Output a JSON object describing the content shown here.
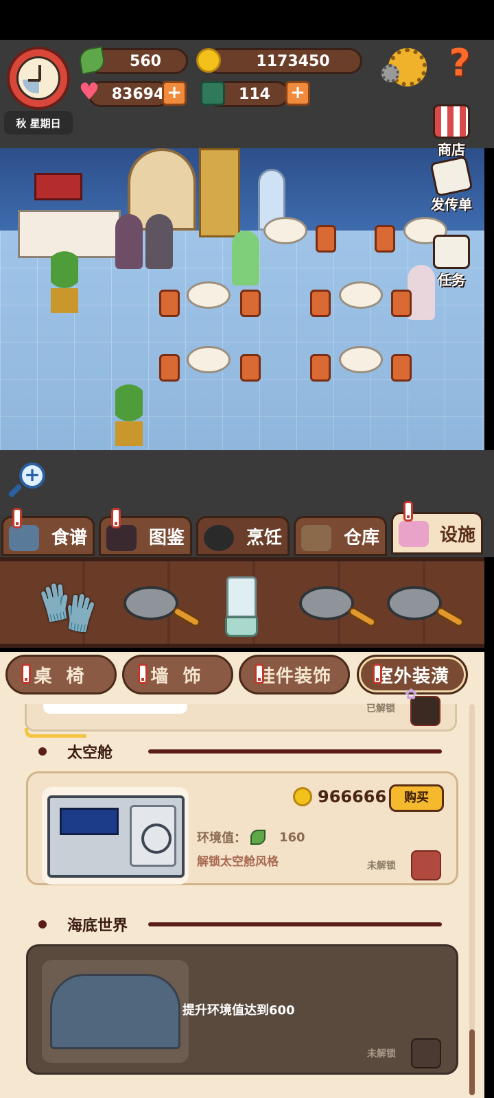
{
  "hud": {
    "season_day": "秋 星期日",
    "leaf_value": "560",
    "coins_value": "1173450",
    "hearts_value": "83694",
    "books_value": "114",
    "plus_symbol": "+",
    "help_symbol": "?"
  },
  "side_buttons": [
    {
      "label": "商店"
    },
    {
      "label": "发传单"
    },
    {
      "label": "任务"
    }
  ],
  "zoom": {
    "symbol": "+"
  },
  "main_tabs": [
    {
      "label": "食谱"
    },
    {
      "label": "图鉴"
    },
    {
      "label": "烹饪",
      "active": true
    },
    {
      "label": "仓库"
    },
    {
      "label": "设施"
    }
  ],
  "sub_tabs": [
    {
      "label": "桌 椅"
    },
    {
      "label": "墙 饰"
    },
    {
      "label": "挂件装饰"
    },
    {
      "label": "室外装潢",
      "active": true
    }
  ],
  "previous_item": {
    "status": "已解锁"
  },
  "sections": [
    {
      "title": "太空舱",
      "price": "966666",
      "buy_label": "购买",
      "env_label": "环境值：",
      "env_value": "160",
      "description": "解锁太空舱风格",
      "status": "未解锁"
    },
    {
      "title": "海底世界",
      "lock_message": "提升环境值达到600",
      "status": "未解锁"
    }
  ],
  "colors": {
    "accent": "#f4b92c",
    "panel_bg": "#f5e7d0",
    "tab_wood": "#7a4a32"
  }
}
